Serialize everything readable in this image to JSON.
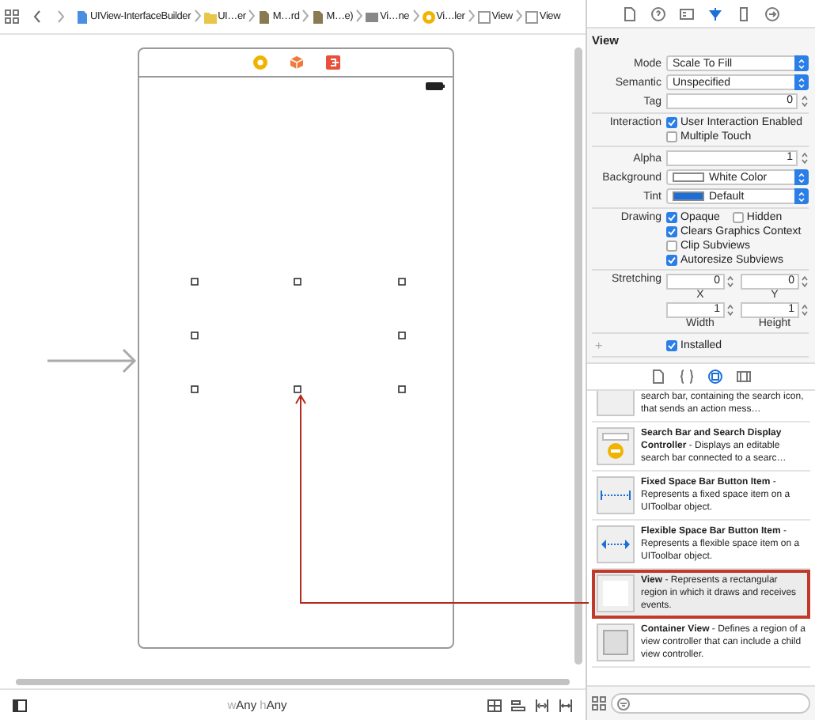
{
  "breadcrumb": [
    {
      "kind": "file",
      "label": "UIView-InterfaceBuilder"
    },
    {
      "kind": "folder",
      "label": "UI…er"
    },
    {
      "kind": "storyboard",
      "label": "M…rd"
    },
    {
      "kind": "storyboard",
      "label": "M…e)"
    },
    {
      "kind": "scene",
      "label": "Vi…ne"
    },
    {
      "kind": "controller",
      "label": "Vi…ler"
    },
    {
      "kind": "view",
      "label": "View"
    },
    {
      "kind": "view",
      "label": "View"
    }
  ],
  "size_class": {
    "width_prefix": "w",
    "width": "Any",
    "height_prefix": "h",
    "height": "Any"
  },
  "inspector": {
    "tabs": [
      {
        "kind": "file",
        "selected": false
      },
      {
        "kind": "help",
        "selected": false
      },
      {
        "kind": "identity",
        "selected": false
      },
      {
        "kind": "attributes",
        "selected": true
      },
      {
        "kind": "size",
        "selected": false
      },
      {
        "kind": "connections",
        "selected": false
      }
    ],
    "title": "View",
    "groups": [
      [
        {
          "kind": "select",
          "label": "Mode",
          "value": "Scale To Fill"
        },
        {
          "kind": "select",
          "label": "Semantic",
          "value": "Unspecified"
        },
        {
          "kind": "number",
          "label": "Tag",
          "value": "0"
        }
      ],
      [
        {
          "kind": "checks",
          "label": "Interaction",
          "lines": [
            [
              {
                "label": "User Interaction Enabled",
                "checked": true
              }
            ],
            [
              {
                "label": "Multiple Touch",
                "checked": false
              }
            ]
          ]
        }
      ],
      [
        {
          "kind": "number",
          "label": "Alpha",
          "value": "1"
        },
        {
          "kind": "color",
          "label": "Background",
          "value": "White Color",
          "color": "#ffffff"
        },
        {
          "kind": "color",
          "label": "Tint",
          "value": "Default",
          "color": "#1b6fd8"
        }
      ],
      [
        {
          "kind": "checks",
          "label": "Drawing",
          "lines": [
            [
              {
                "label": "Opaque",
                "checked": true
              },
              {
                "label": "Hidden",
                "checked": false
              }
            ],
            [
              {
                "label": "Clears Graphics Context",
                "checked": true
              }
            ],
            [
              {
                "label": "Clip Subviews",
                "checked": false
              }
            ],
            [
              {
                "label": "Autoresize Subviews",
                "checked": true
              }
            ]
          ]
        }
      ],
      [
        {
          "kind": "stretching",
          "label": "Stretching",
          "fields": [
            {
              "value": "0",
              "caption": "X"
            },
            {
              "value": "0",
              "caption": "Y"
            },
            {
              "value": "1",
              "caption": "Width"
            },
            {
              "value": "1",
              "caption": "Height"
            }
          ]
        }
      ],
      [
        {
          "kind": "installed",
          "add": "+",
          "label": "Installed",
          "checked": true
        }
      ]
    ]
  },
  "library": {
    "tabs": [
      {
        "kind": "file",
        "selected": false
      },
      {
        "kind": "code",
        "selected": false
      },
      {
        "kind": "object",
        "selected": true
      },
      {
        "kind": "media",
        "selected": false
      }
    ],
    "items": [
      {
        "kind": "searchbar",
        "text": "search bar, containing the search icon, that sends an action mess…",
        "selected": false
      },
      {
        "kind": "search-display",
        "text": "**Search Bar and Search Display Controller** - Displays an editable search bar connected to a searc…",
        "selected": false
      },
      {
        "kind": "fixed-space",
        "text": "**Fixed Space Bar Button Item** - Represents a fixed space item on a UIToolbar object.",
        "selected": false
      },
      {
        "kind": "flexible-space",
        "text": "**Flexible Space Bar Button Item** - Represents a flexible space item on a UIToolbar object.",
        "selected": false
      },
      {
        "kind": "view",
        "text": "**View** - Represents a rectangular region in which it draws and receives events.",
        "selected": true
      },
      {
        "kind": "container",
        "text": "**Container View** - Defines a region of a view controller that can include a child view controller.",
        "selected": false
      }
    ]
  }
}
